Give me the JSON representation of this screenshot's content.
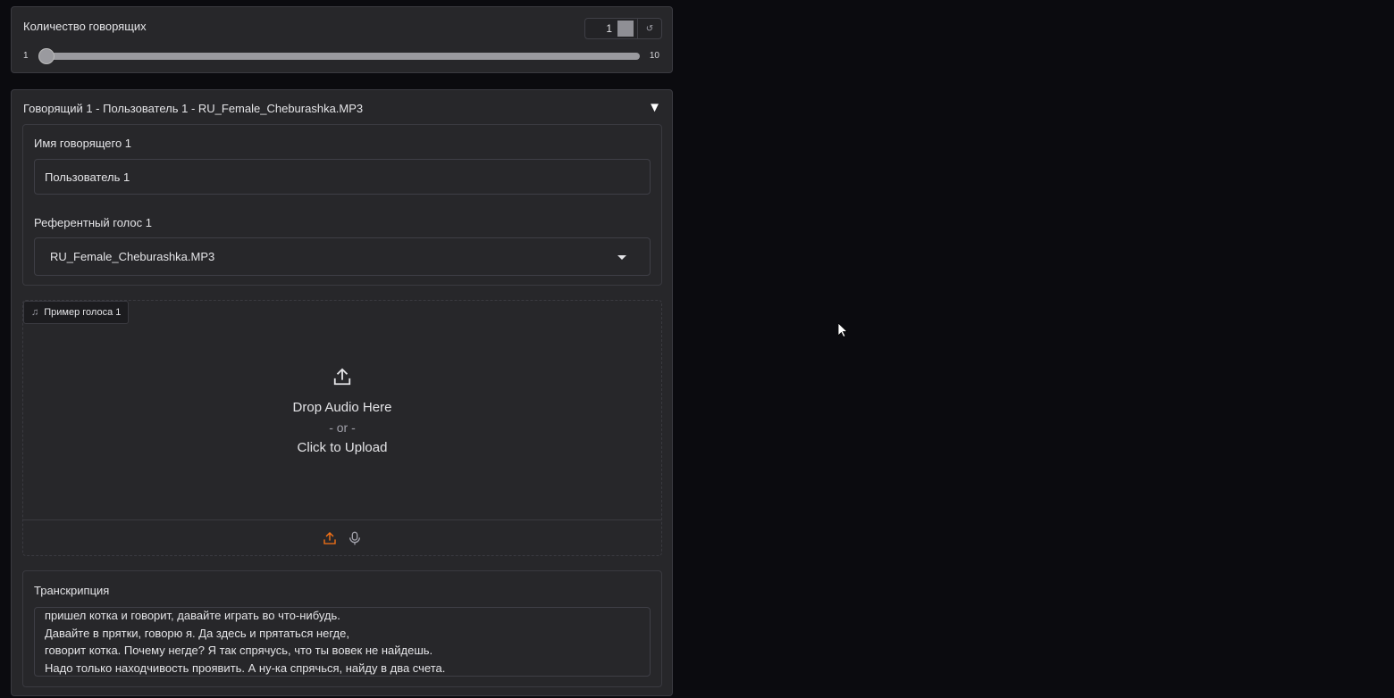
{
  "speaker_count": {
    "label": "Количество говорящих",
    "value": "1",
    "min": "1",
    "max": "10",
    "reset_icon": "↺"
  },
  "speaker": {
    "header": "Говорящий 1 - Пользователь 1 - RU_Female_Cheburashka.MP3",
    "collapse_icon": "▼",
    "name_label": "Имя говорящего 1",
    "name_value": "Пользователь 1",
    "voice_label": "Референтный голос 1",
    "voice_value": "RU_Female_Cheburashka.MP3",
    "audio_label": "Пример голоса 1",
    "drop_text": "Drop Audio Here",
    "or_text": "- or -",
    "click_text": "Click to Upload",
    "transcription_label": "Транскрипция",
    "transcription_lines": [
      "пришел котка и говорит, давайте играть во что-нибудь.",
      "Давайте в прятки, говорю я. Да здесь и прятаться негде,",
      "говорит котка. Почему негде? Я так спрячусь, что ты вовек не найдешь.",
      "Надо только находчивость проявить. А ну-ка спрячься, найду в два счета."
    ]
  },
  "colors": {
    "accent": "#f97316"
  }
}
